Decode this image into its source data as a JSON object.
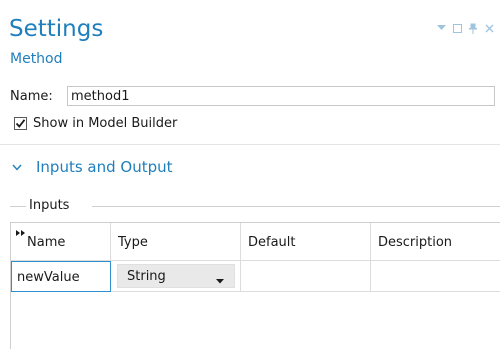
{
  "header": {
    "title": "Settings",
    "subtitle": "Method"
  },
  "window_controls": {
    "icons": [
      "dropdown-arrow-icon",
      "maximize-icon",
      "pin-icon",
      "close-icon"
    ],
    "color": "#9ec4de"
  },
  "form": {
    "name_label": "Name:",
    "name_value": "method1",
    "show_in_model_builder_label": "Show in Model Builder",
    "show_in_model_builder_checked": true
  },
  "section": {
    "title": "Inputs and Output",
    "expanded": true
  },
  "inputs_group": {
    "label": "Inputs",
    "columns": [
      "Name",
      "Type",
      "Default",
      "Description"
    ],
    "rows": [
      {
        "name": "newValue",
        "type": "String",
        "default": "",
        "description": ""
      }
    ]
  },
  "colors": {
    "accent": "#1f7fbd",
    "edit_border": "#2f8fd0"
  }
}
